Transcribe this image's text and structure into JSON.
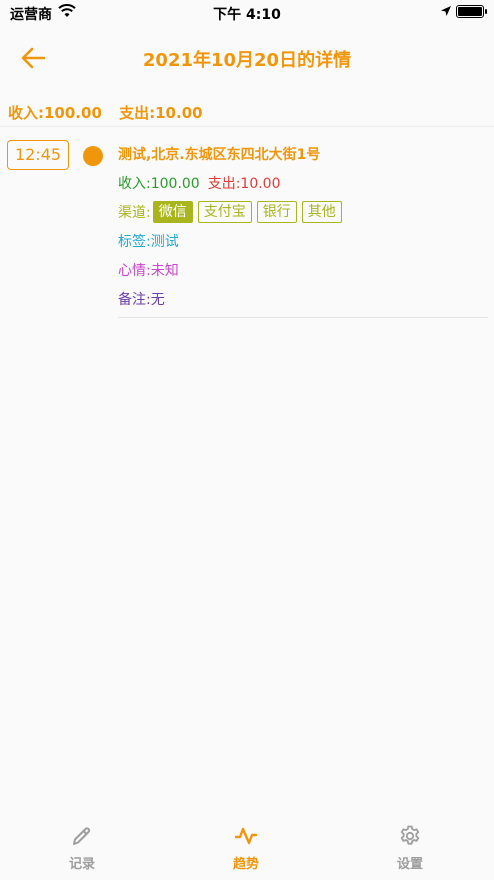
{
  "status_bar": {
    "carrier": "运营商",
    "time": "下午 4:10"
  },
  "nav": {
    "title": "2021年10月20日的详情"
  },
  "summary": {
    "income": "收入:100.00",
    "expense": "支出:10.00"
  },
  "entry": {
    "time": "12:45",
    "address": "测试,北京.东城区东四北大街1号",
    "income": "收入:100.00",
    "expense": "支出:10.00",
    "channel_label": "渠道:",
    "channels": [
      "微信",
      "支付宝",
      "银行",
      "其他"
    ],
    "selected_channel": "微信",
    "tag_label": "标签:",
    "tag_value": "测试",
    "mood_label": "心情:",
    "mood_value": "未知",
    "note_label": "备注:",
    "note_value": "无"
  },
  "tabs": [
    {
      "label": "记录",
      "icon": "pencil-icon"
    },
    {
      "label": "趋势",
      "icon": "trend-wave-icon",
      "active": true
    },
    {
      "label": "设置",
      "icon": "gear-icon"
    }
  ],
  "colors": {
    "accent": "#f0960c",
    "income": "#2a9a2a",
    "expense": "#e53935",
    "channel": "#a9b51c",
    "tag": "#1fa8d0",
    "mood": "#c846c8",
    "note": "#6a3ea8"
  }
}
